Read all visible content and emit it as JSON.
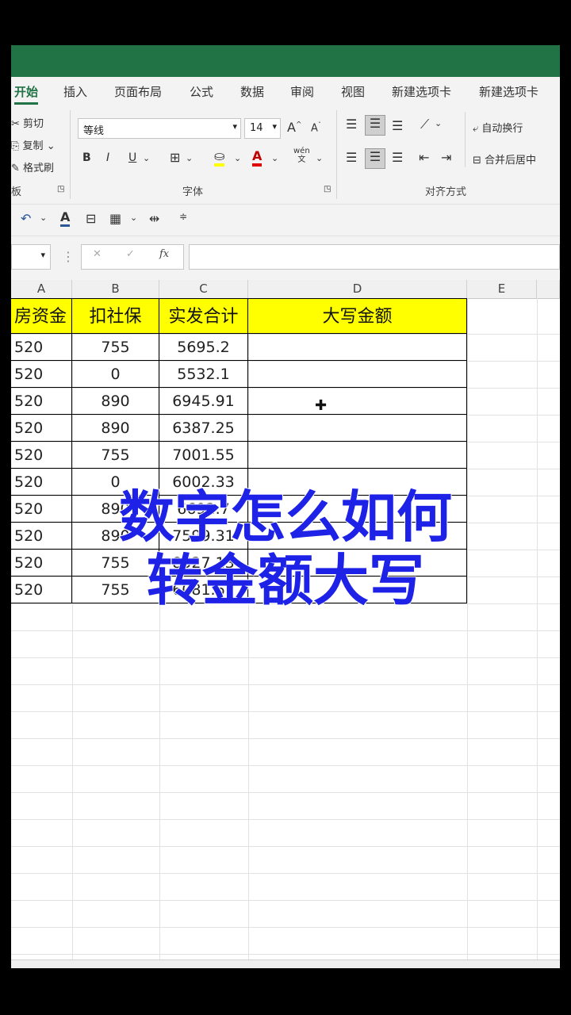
{
  "ribbon": {
    "tabs": [
      "开始",
      "插入",
      "页面布局",
      "公式",
      "数据",
      "审阅",
      "视图",
      "新建选项卡",
      "新建选项卡"
    ],
    "clipboard": {
      "cut": "剪切",
      "copy": "复制",
      "format_painter": "格式刷",
      "group_label": "板"
    },
    "font": {
      "name": "等线",
      "size": "14",
      "group_label": "字体",
      "pinyin": "wén"
    },
    "alignment": {
      "wrap_text": "自动换行",
      "merge_center": "合并后居中",
      "group_label": "对齐方式"
    }
  },
  "formula_bar": {
    "name_box": "",
    "fx": "fx",
    "value": ""
  },
  "columns": [
    "A",
    "B",
    "C",
    "D",
    "E"
  ],
  "table": {
    "headers": [
      "房资金",
      "扣社保",
      "实发合计",
      "大写金额"
    ],
    "rows": [
      [
        "520",
        "755",
        "5695.2",
        ""
      ],
      [
        "520",
        "0",
        "5532.1",
        ""
      ],
      [
        "520",
        "890",
        "6945.91",
        ""
      ],
      [
        "520",
        "890",
        "6387.25",
        ""
      ],
      [
        "520",
        "755",
        "7001.55",
        ""
      ],
      [
        "520",
        "0",
        "6002.33",
        ""
      ],
      [
        "520",
        "890",
        "6692.7",
        ""
      ],
      [
        "520",
        "890",
        "7599.31",
        ""
      ],
      [
        "520",
        "755",
        "8527.13",
        ""
      ],
      [
        "520",
        "755",
        "6081.66",
        ""
      ]
    ]
  },
  "overlay": {
    "line1": "数字怎么如何",
    "line2": "转金额大写"
  },
  "colors": {
    "accent": "#217346",
    "header_fill": "#ffff00",
    "overlay_text": "#1e22e6"
  }
}
